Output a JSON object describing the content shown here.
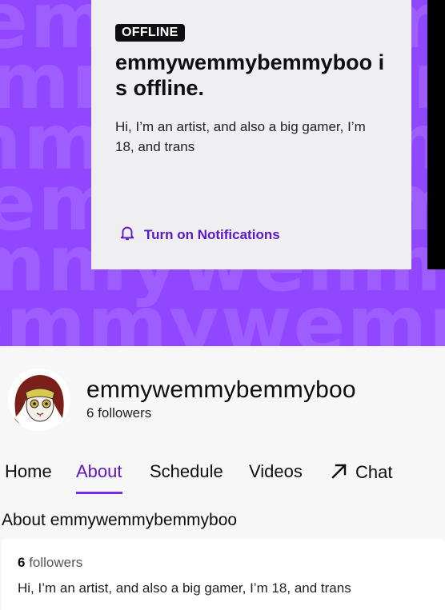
{
  "banner": {
    "watermark_text": "emmywemmybemmyboo",
    "color": "#9147ff"
  },
  "offline_card": {
    "badge": "OFFLINE",
    "title": "emmywemmybemmyboo is offline.",
    "description": "Hi, I’m an artist, and also a big gamer, I’m 18, and trans",
    "notify_label": "Turn on Notifications",
    "notify_icon": "bell-icon"
  },
  "profile": {
    "name": "emmywemmybemmyboo",
    "followers": "6 followers"
  },
  "tabs": [
    {
      "label": "Home",
      "active": false
    },
    {
      "label": "About",
      "active": true
    },
    {
      "label": "Schedule",
      "active": false
    },
    {
      "label": "Videos",
      "active": false
    },
    {
      "label": "Chat",
      "active": false,
      "icon": "external-arrow-icon"
    }
  ],
  "about": {
    "heading": "About emmywemmybemmyboo",
    "followers_count": "6",
    "followers_word": "followers",
    "bio": "Hi, I’m an artist, and also a big gamer, I’m 18, and trans"
  },
  "colors": {
    "accent": "#772ce8",
    "accent_text": "#5c16c5"
  }
}
